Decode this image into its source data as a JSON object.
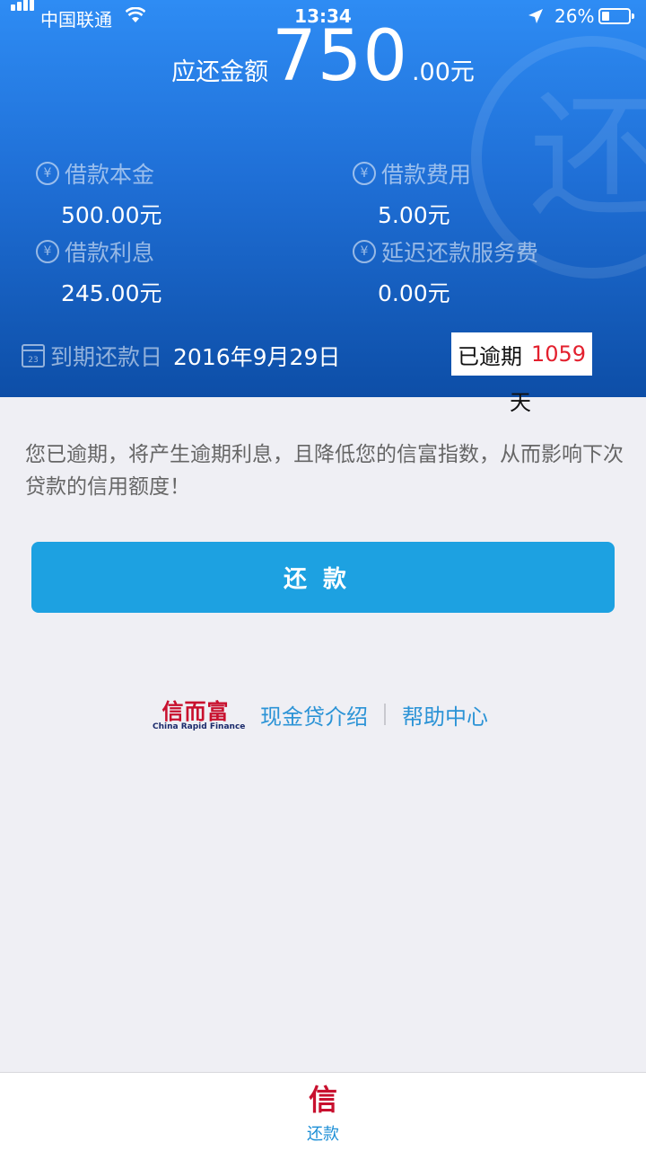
{
  "status_bar": {
    "carrier": "中国联通",
    "time": "13:34",
    "battery_percent": "26%"
  },
  "header": {
    "amount_label": "应还金额",
    "amount_integer": "750",
    "amount_decimal": ".00元",
    "items": [
      {
        "label": "借款本金",
        "value": "500.00元"
      },
      {
        "label": "借款费用",
        "value": "5.00元"
      },
      {
        "label": "借款利息",
        "value": "245.00元"
      },
      {
        "label": "延迟还款服务费",
        "value": "0.00元"
      }
    ],
    "due_label": "到期还款日",
    "due_date": "2016年9月29日",
    "calendar_day": "23",
    "overdue_prefix": "已逾期",
    "overdue_days": "1059",
    "overdue_unit": "天",
    "watermark_char": "还"
  },
  "notice": "您已逾期，将产生逾期利息，且降低您的信富指数，从而影响下次贷款的信用额度！",
  "pay_button": "还款",
  "footer": {
    "brand_cn": "信而富",
    "brand_en": "China Rapid Finance",
    "link_intro": "现金贷介绍",
    "separator": "|",
    "link_help": "帮助中心"
  },
  "tabbar": {
    "tab_icon_glyph": "信",
    "tab_label": "还款"
  },
  "colors": {
    "accent": "#1da1e1",
    "overdue": "#e3202e",
    "brand_red": "#c8102e"
  }
}
